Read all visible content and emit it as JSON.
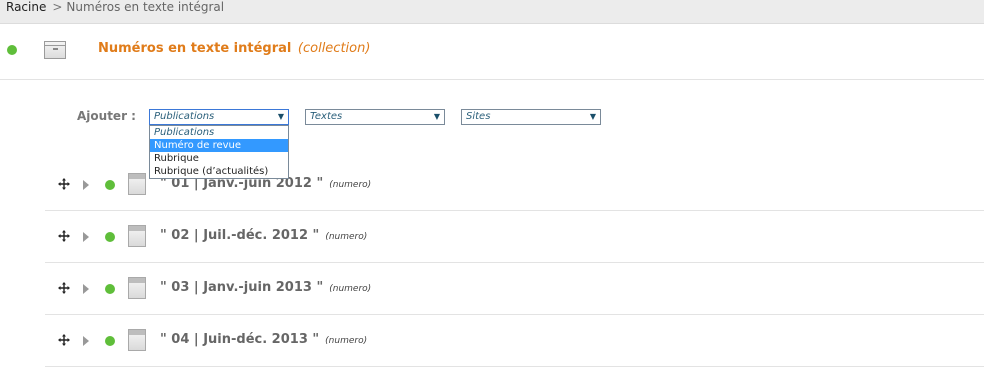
{
  "breadcrumb": {
    "root": "Racine",
    "separator": ">",
    "current": "Numéros en texte intégral"
  },
  "collection": {
    "title": "Numéros en texte intégral",
    "type": "(collection)",
    "status_color": "#5fbe3a"
  },
  "add": {
    "label": "Ajouter :",
    "selects": [
      {
        "value": "Publications"
      },
      {
        "value": "Textes"
      },
      {
        "value": "Sites"
      }
    ],
    "dropdown_options": [
      "Publications",
      "Numéro de revue",
      "Rubrique",
      "Rubrique (d’actualités)"
    ],
    "highlighted_option": "Numéro de revue"
  },
  "items": [
    {
      "title": "\" 01 | Janv.-juin 2012 \"",
      "type": "(numero)"
    },
    {
      "title": "\" 02 | Juil.-déc. 2012 \"",
      "type": "(numero)"
    },
    {
      "title": "\" 03 | Janv.-juin 2013 \"",
      "type": "(numero)"
    },
    {
      "title": "\" 04 | Juin-déc. 2013 \"",
      "type": "(numero)"
    }
  ],
  "icons": {
    "move": "move-cross-icon",
    "expand": "expand-triangle-icon",
    "status": "status-dot-icon",
    "document": "document-icon",
    "collection": "collection-icon"
  }
}
